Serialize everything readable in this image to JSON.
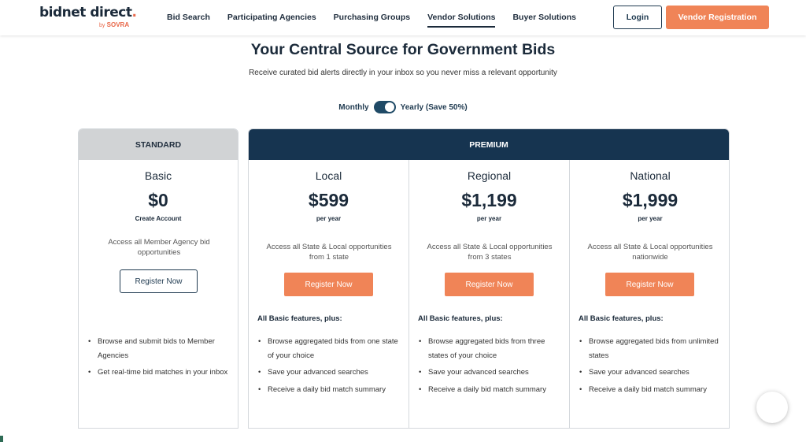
{
  "header": {
    "logo_text": "bidnet direct",
    "logo_dot": ".",
    "logo_by": "by",
    "logo_brand": "SOVRA",
    "nav": [
      {
        "label": "Bid Search"
      },
      {
        "label": "Participating Agencies"
      },
      {
        "label": "Purchasing Groups"
      },
      {
        "label": "Vendor Solutions",
        "active": true
      },
      {
        "label": "Buyer Solutions"
      }
    ],
    "login_label": "Login",
    "register_label": "Vendor Registration"
  },
  "hero": {
    "title": "Your Central Source for Government Bids",
    "subtitle": "Receive curated bid alerts directly in your inbox so you never miss a relevant opportunity"
  },
  "billing_toggle": {
    "left_label": "Monthly",
    "right_label": "Yearly (Save 50%)",
    "selected": "Yearly"
  },
  "standard": {
    "header": "STANDARD",
    "plan": {
      "name": "Basic",
      "price": "$0",
      "period": "Create Account",
      "description": "Access all Member Agency bid opportunities",
      "button": "Register Now",
      "features": [
        "Browse and submit bids to Member Agencies",
        "Get real-time bid matches in your inbox"
      ]
    }
  },
  "premium": {
    "header": "PREMIUM",
    "plans": [
      {
        "name": "Local",
        "price": "$599",
        "period": "per year",
        "description": "Access all State & Local opportunities from 1 state",
        "button": "Register Now",
        "plus_label": "All Basic features, plus:",
        "features": [
          "Browse aggregated bids from one state of your choice",
          "Save your advanced searches",
          "Receive a daily bid match summary"
        ]
      },
      {
        "name": "Regional",
        "price": "$1,199",
        "period": "per year",
        "description": "Access all State & Local opportunities from 3 states",
        "button": "Register Now",
        "plus_label": "All Basic features, plus:",
        "features": [
          "Browse aggregated bids from three states of your choice",
          "Save your advanced searches",
          "Receive a daily bid match summary"
        ]
      },
      {
        "name": "National",
        "price": "$1,999",
        "period": "per year",
        "description": "Access all State & Local opportunities nationwide",
        "button": "Register Now",
        "plus_label": "All Basic features, plus:",
        "features": [
          "Browse aggregated bids from unlimited states",
          "Save your advanced searches",
          "Receive a daily bid match summary"
        ]
      }
    ]
  },
  "colors": {
    "accent_orange": "#f08457",
    "navy": "#163450",
    "standard_header": "#d1d3d5"
  }
}
